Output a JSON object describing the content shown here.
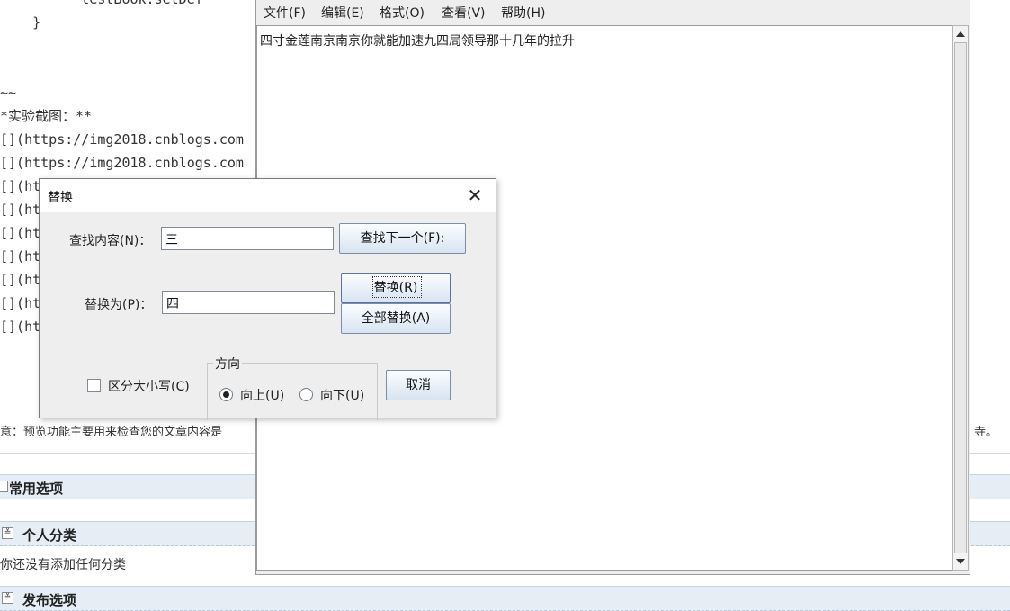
{
  "editor": {
    "code_lines": [
      "          testBook.setDef",
      "    }",
      "",
      "",
      "~~",
      "*实验截图：**",
      "[](https://img2018.cnblogs.com",
      "[](https://img2018.cnblogs.com",
      "[](htt",
      "[](htt",
      "[](htt",
      "[](htt",
      "[](htt",
      "[](htt",
      "[](htt"
    ],
    "notice_head": "意：预览功能主要用来检查您的文章内容是",
    "notice_tail": "寺。",
    "sections": [
      {
        "title": "常用选项",
        "toggle": ""
      },
      {
        "title": "个人分类",
        "toggle": "≚"
      },
      {
        "title": "发布选项",
        "toggle": "≚"
      }
    ],
    "no_category_text": "你还没有添加任何分类"
  },
  "notepad": {
    "menus": [
      "文件(F)",
      "编辑(E)",
      "格式(O)",
      "查看(V)",
      "帮助(H)"
    ],
    "content": "四寸金莲南京南京你就能加速九四局领导那十几年的拉升"
  },
  "replace_dialog": {
    "title": "替换",
    "close_glyph": "✕",
    "find_label": "查找内容(N)：",
    "find_value": "三",
    "replace_label": "替换为(P)：",
    "replace_value": "四",
    "find_next_button": "查找下一个(F):",
    "replace_button": "替换(R)",
    "replace_all_button": "全部替换(A)",
    "cancel_button": "取消",
    "match_case_label": "区分大小写(C)",
    "match_case_checked": false,
    "direction_title": "方向",
    "direction_up": "向上(U)",
    "direction_down": "向下(U)",
    "direction_selected": "up"
  }
}
